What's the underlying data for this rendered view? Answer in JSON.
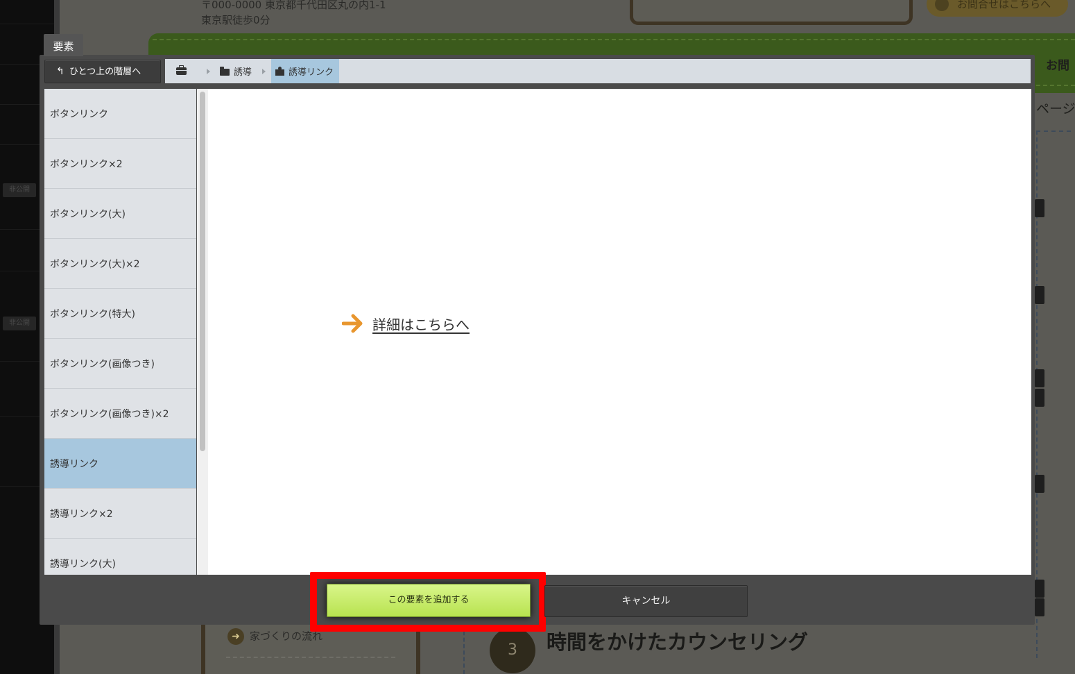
{
  "background": {
    "address_line1": "〒000-0000 東京都千代田区丸の内1-1",
    "address_line2": "東京駅徒歩0分",
    "contact_link": "お問合せはこちらへ",
    "right_inquiry": "お問",
    "right_page": "ページ",
    "flow_link": "家づくりの流れ",
    "step_number": "3",
    "heading": "時間をかけたカウンセリング",
    "left_tag_1": "非公開",
    "left_tag_2": "非公開"
  },
  "modal": {
    "tab_label": "要素",
    "back_button": "ひとつ上の階層へ",
    "breadcrumb": [
      {
        "icon": "briefcase-icon",
        "label": ""
      },
      {
        "icon": "folder-icon",
        "label": "誘導"
      },
      {
        "icon": "puzzle-icon",
        "label": "誘導リンク"
      }
    ],
    "sidebar_items": [
      {
        "label": "ボタンリンク",
        "selected": false
      },
      {
        "label": "ボタンリンク×2",
        "selected": false
      },
      {
        "label": "ボタンリンク(大)",
        "selected": false
      },
      {
        "label": "ボタンリンク(大)×2",
        "selected": false
      },
      {
        "label": "ボタンリンク(特大)",
        "selected": false
      },
      {
        "label": "ボタンリンク(画像つき)",
        "selected": false
      },
      {
        "label": "ボタンリンク(画像つき)×2",
        "selected": false
      },
      {
        "label": "誘導リンク",
        "selected": true
      },
      {
        "label": "誘導リンク×2",
        "selected": false
      },
      {
        "label": "誘導リンク(大)",
        "selected": false
      }
    ],
    "preview": {
      "link_text": "詳細はこちらへ",
      "arrow_color": "#e8962e"
    },
    "add_button": "この要素を追加する",
    "cancel_button": "キャンセル"
  },
  "colors": {
    "highlight": "#ff0000",
    "selected": "#a7c7de",
    "add_button": "#c6ec6a"
  }
}
